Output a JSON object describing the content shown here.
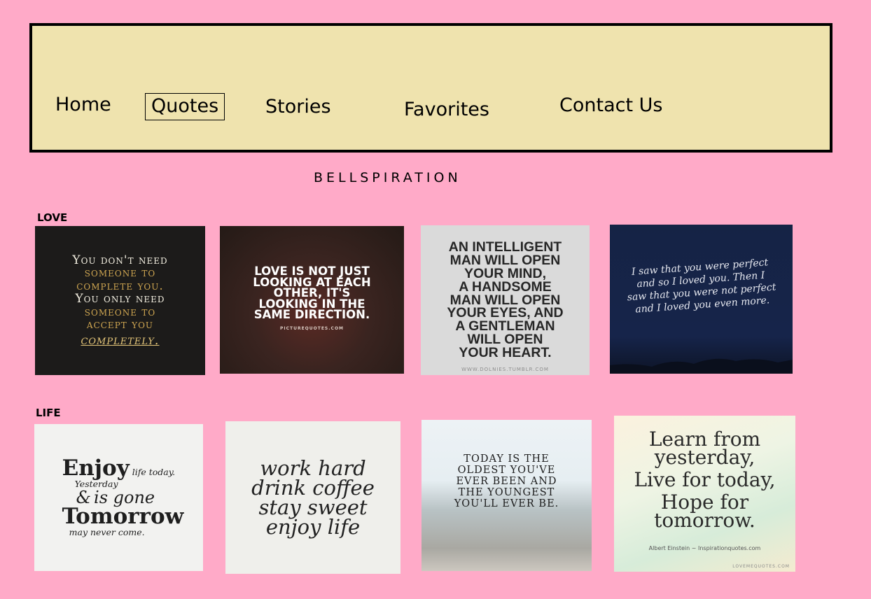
{
  "nav": {
    "items": [
      {
        "label": "Home"
      },
      {
        "label": "Quotes"
      },
      {
        "label": "Stories"
      },
      {
        "label": "Favorites"
      },
      {
        "label": "Contact Us"
      }
    ]
  },
  "site_title": "BELLSPIRATION",
  "sections": [
    {
      "label": "LOVE",
      "tiles": [
        {
          "lines": [
            "You don't need",
            "someone to",
            "complete you.",
            "You only need",
            "someone to",
            "accept you"
          ],
          "script": "completely."
        },
        {
          "lines": [
            "Love is not just",
            "looking at each",
            "other, it's",
            "looking in the",
            "same direction."
          ],
          "credit": "PictureQuotes.com"
        },
        {
          "lines": [
            "AN INTELLIGENT",
            "MAN WILL OPEN",
            "YOUR MIND,",
            "A HANDSOME",
            "MAN WILL OPEN",
            "YOUR EYES, AND",
            "A GENTLEMAN",
            "WILL OPEN",
            "YOUR HEART."
          ],
          "credit": "WWW.DOLNIES.TUMBLR.COM"
        },
        {
          "lines": [
            "I saw that you were perfect",
            "and so I loved you. Then I",
            "saw that you were not perfect",
            "and I loved you even more."
          ]
        }
      ]
    },
    {
      "label": "LIFE",
      "tiles": [
        {
          "enjoy": "Enjoy",
          "life_today": "life today.",
          "yesterday": "Yesterday",
          "and": "&",
          "is_gone": "is gone",
          "tomorrow": "Tomorrow",
          "may_never": "may never come."
        },
        {
          "lines": [
            "work hard",
            "drink coffee",
            "stay sweet",
            "enjoy life"
          ]
        },
        {
          "lines": [
            "TODAY IS THE",
            "OLDEST YOU'VE",
            "EVER BEEN AND",
            "THE YOUNGEST",
            "YOU'LL EVER BE."
          ]
        },
        {
          "lines": [
            "Learn from",
            "yesterday,",
            "Live for today,",
            "Hope for",
            "tomorrow."
          ],
          "author": "Albert Einstein ~ Inspirationquotes.com",
          "credit": "LOVEMEQUOTES.COM"
        }
      ]
    }
  ],
  "colors": {
    "page_background": "#ffaac8",
    "nav_background": "#efe3ae",
    "nav_border": "#000000"
  }
}
